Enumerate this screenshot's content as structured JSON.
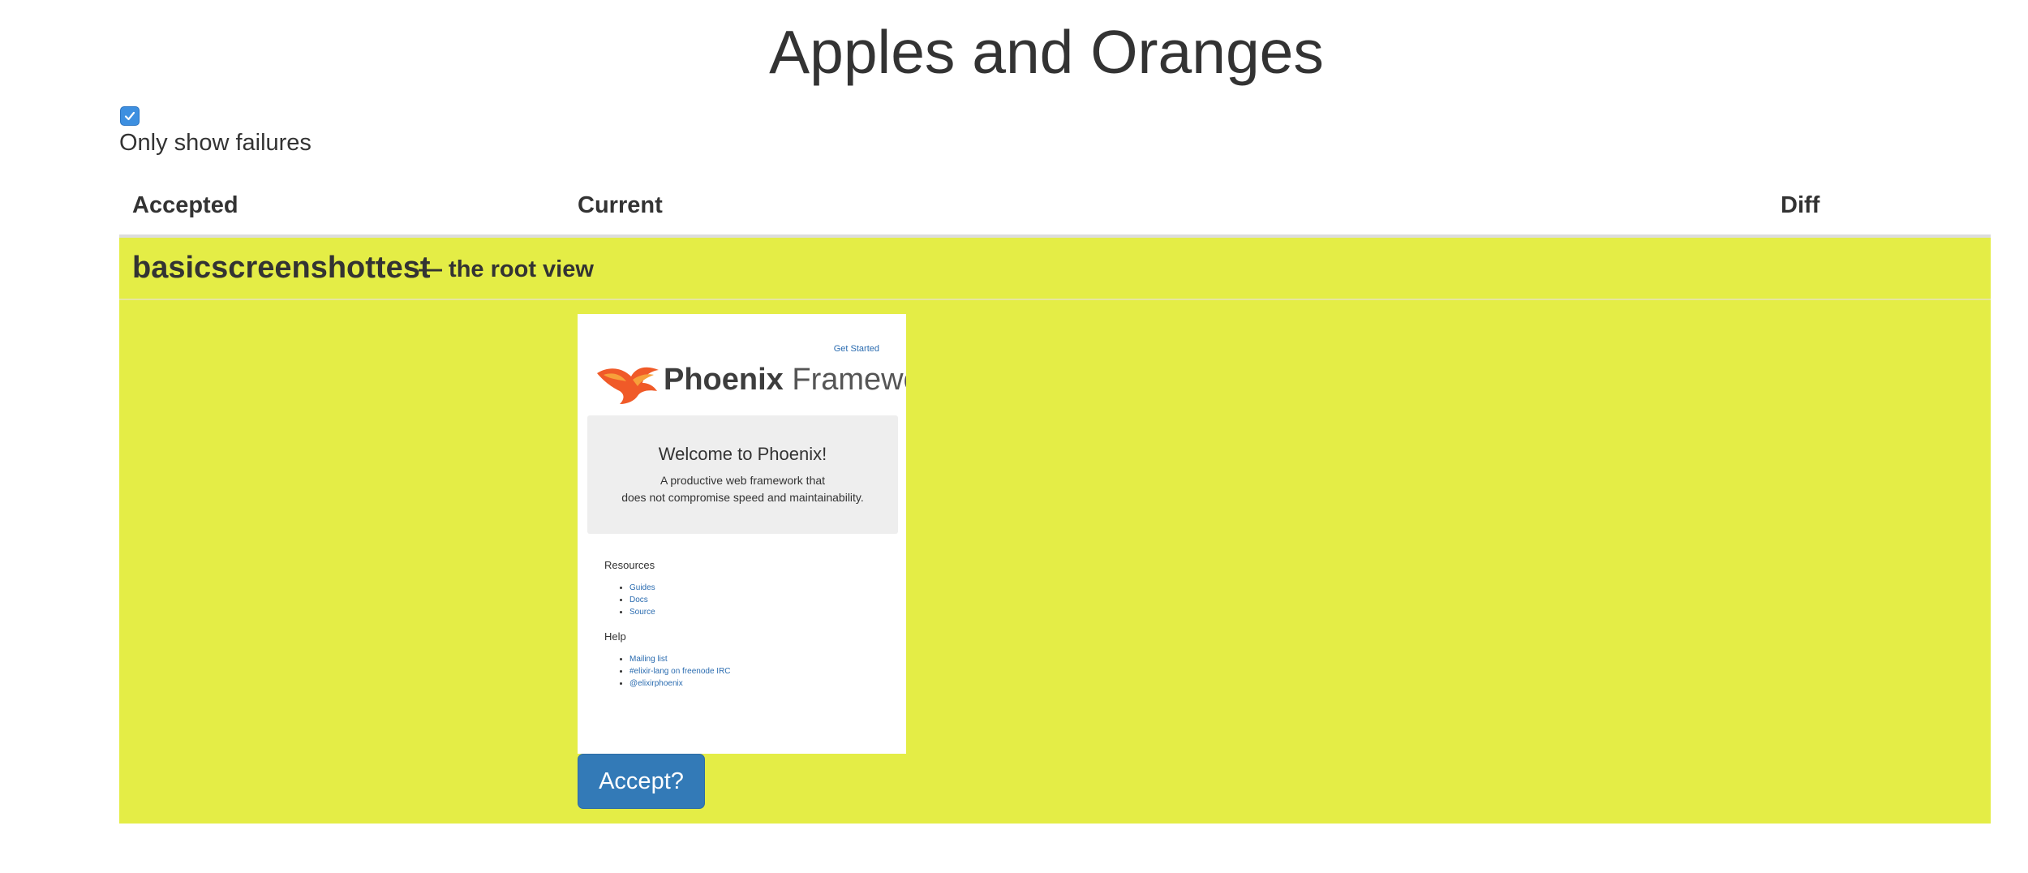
{
  "page": {
    "title": "Apples and Oranges"
  },
  "filter": {
    "label": "Only show failures",
    "checked": true
  },
  "table": {
    "headers": [
      "Accepted",
      "Current",
      "Diff"
    ],
    "rows": [
      {
        "test_name": "basicscreenshottest",
        "description": "— the root view",
        "status_color": "#e4ed46",
        "snapshot": {
          "get_started_link": "Get Started",
          "logo_bold": "Phoenix",
          "logo_light": " Framework",
          "jumbotron_title": "Welcome to Phoenix!",
          "jumbotron_line1": "A productive web framework that",
          "jumbotron_line2": "does not compromise speed and maintainability.",
          "resources_title": "Resources",
          "resources_links": [
            "Guides",
            "Docs",
            "Source"
          ],
          "help_title": "Help",
          "help_links": [
            "Mailing list",
            "#elixir-lang on freenode IRC",
            "@elixirphoenix"
          ]
        },
        "accept_label": "Accept?"
      }
    ]
  },
  "colors": {
    "accent": "#337ab7",
    "checkbox": "#3d8fe0",
    "row_highlight": "#e4ed46"
  }
}
